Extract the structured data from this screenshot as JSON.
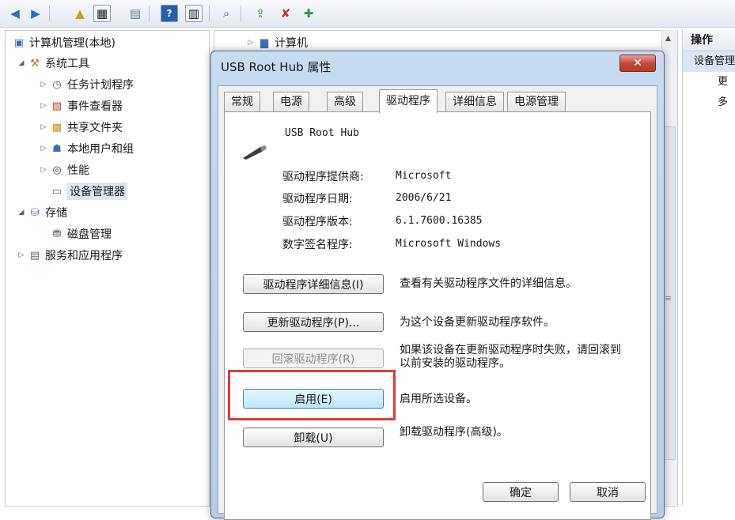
{
  "toolbar": {
    "icons": [
      "back-arrow-icon",
      "forward-arrow-icon",
      "up-folder-icon",
      "show-hide-tree-icon",
      "properties-icon",
      "help-icon",
      "action-pane-icon",
      "scan-hardware-icon",
      "update-driver-icon",
      "disable-device-icon",
      "enable-device-icon"
    ]
  },
  "tree": {
    "root": {
      "label": "计算机管理(本地)"
    },
    "system_tools": {
      "label": "系统工具",
      "expander": "◢"
    },
    "task_scheduler": {
      "label": "任务计划程序",
      "expander": "▷"
    },
    "event_viewer": {
      "label": "事件查看器",
      "expander": "▷"
    },
    "shared_folders": {
      "label": "共享文件夹",
      "expander": "▷"
    },
    "local_users": {
      "label": "本地用户和组",
      "expander": "▷"
    },
    "performance": {
      "label": "性能",
      "expander": "▷"
    },
    "device_manager": {
      "label": "设备管理器"
    },
    "storage": {
      "label": "存储",
      "expander": "◢"
    },
    "disk_management": {
      "label": "磁盘管理"
    },
    "services": {
      "label": "服务和应用程序",
      "expander": "▷"
    }
  },
  "center": {
    "computer_node": {
      "label": "计算机",
      "expander": "▷"
    },
    "scroll_up": "▲",
    "scroll_mark": "≡"
  },
  "actions": {
    "header": "操作",
    "selected": "设备管理",
    "more": "更多"
  },
  "dialog": {
    "title": "USB Root Hub 属性",
    "close": "✕",
    "tabs": [
      "常规",
      "电源",
      "高级",
      "驱动程序",
      "详细信息",
      "电源管理"
    ],
    "active_tab": "驱动程序",
    "device_name": "USB Root Hub",
    "props": [
      {
        "label": "驱动程序提供商:",
        "value": "Microsoft"
      },
      {
        "label": "驱动程序日期:",
        "value": "2006/6/21"
      },
      {
        "label": "驱动程序版本:",
        "value": "6.1.7600.16385"
      },
      {
        "label": "数字签名程序:",
        "value": "Microsoft Windows"
      }
    ],
    "buttons": [
      {
        "label": "驱动程序详细信息(I)",
        "desc": "查看有关驱动程序文件的详细信息。",
        "state": "normal"
      },
      {
        "label": "更新驱动程序(P)...",
        "desc": "为这个设备更新驱动程序软件。",
        "state": "normal"
      },
      {
        "label": "回滚驱动程序(R)",
        "desc": "如果该设备在更新驱动程序时失败，请回滚到以前安装的驱动程序。",
        "state": "disabled"
      },
      {
        "label": "启用(E)",
        "desc": "启用所选设备。",
        "state": "focused"
      },
      {
        "label": "卸载(U)",
        "desc": "卸载驱动程序(高级)。",
        "state": "normal"
      }
    ],
    "ok": "确定",
    "cancel": "取消"
  }
}
